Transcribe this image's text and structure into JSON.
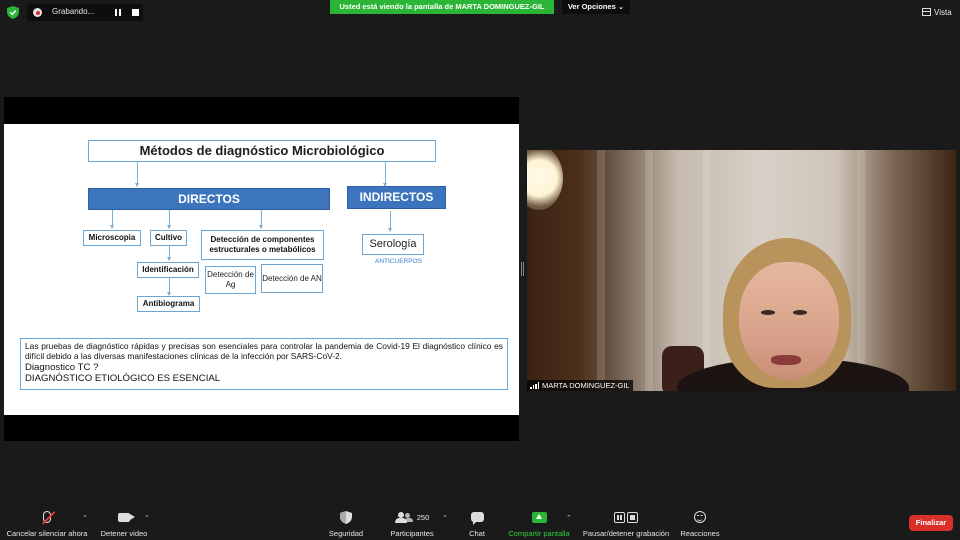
{
  "recording": {
    "label": "Grabando..."
  },
  "banner": {
    "text": "Usted está viendo la pantalla de MARTA DOMINGUEZ-GIL",
    "options_label": "Ver Opciones"
  },
  "view": {
    "label": "Vista"
  },
  "slide": {
    "title": "Métodos de diagnóstico Microbiológico",
    "directos": "DIRECTOS",
    "indirectos": "INDIRECTOS",
    "microscopia": "Microscopia",
    "cultivo": "Cultivo",
    "deteccion_componentes": "Detección de componentes estructurales o metabólicos",
    "identificacion": "Identificación",
    "antibiograma": "Antibiograma",
    "deteccion_ag": "Detección de Ag",
    "deteccion_an": "Detección de AN",
    "serologia": "Serología",
    "anticuerpos": "ANTICUERPOS",
    "paragraph": "Las pruebas de diagnóstico rápidas y precisas son esenciales para controlar la pandemia de Covid-19 El diagnóstico clínico es difícil debido a las diversas manifestaciones clínicas de la infección por SARS-CoV-2.",
    "diagnostico_tc": "Diagnostico TC ?",
    "essential": "DIAGNÓSTICO ETIOLÓGICO ES ESENCIAL"
  },
  "video": {
    "participant_name": "MARTA DOMINGUEZ-GIL"
  },
  "toolbar": {
    "mute": "Cancelar silenciar ahora",
    "video": "Detener video",
    "security": "Seguridad",
    "participants": "Participantes",
    "participants_count": "250",
    "chat": "Chat",
    "share": "Compartir pantalla",
    "record": "Pausar/detener grabación",
    "reactions": "Reacciones",
    "end": "Finalizar"
  },
  "colors": {
    "share_green": "#2bb536",
    "end_red": "#d9302c",
    "slide_blue": "#3c74be"
  }
}
